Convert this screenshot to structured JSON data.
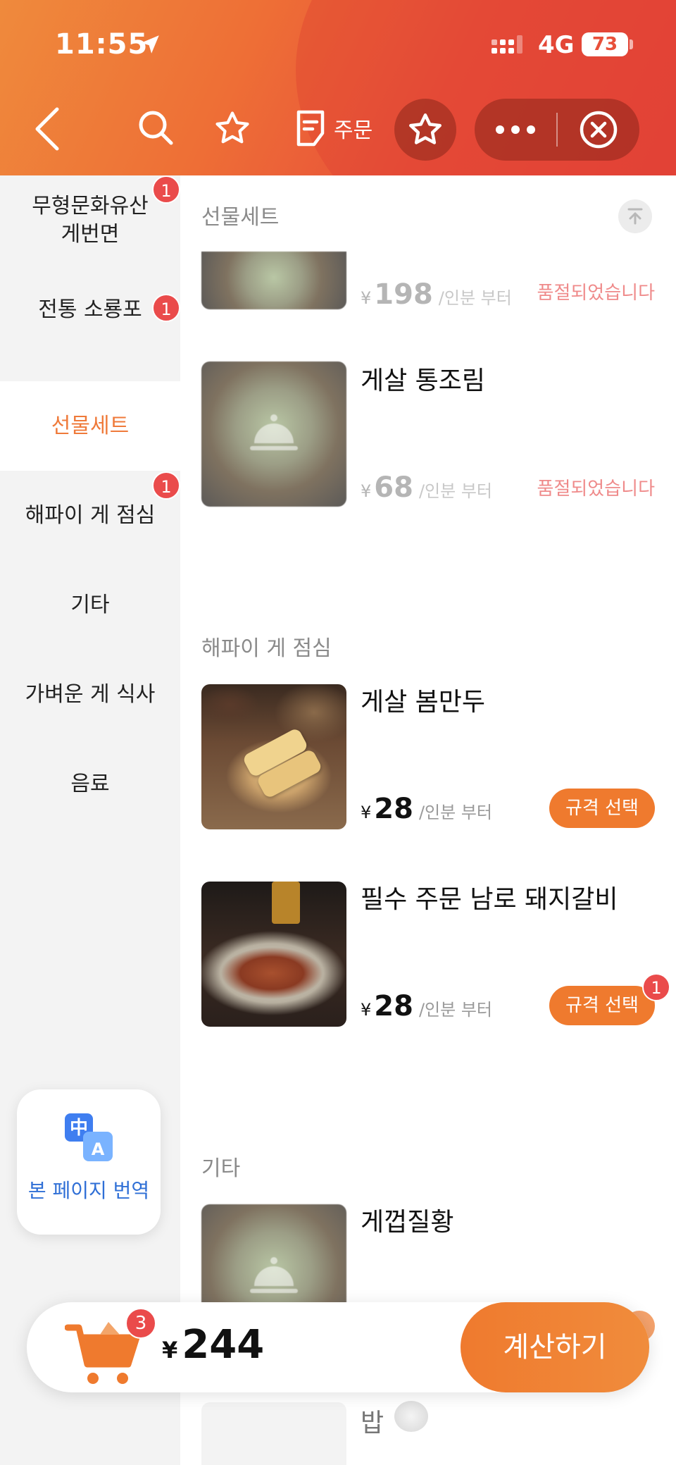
{
  "status_bar": {
    "time": "11:55",
    "network": "4G",
    "battery": "73"
  },
  "header": {
    "order_label": "주문",
    "icons": [
      "back-icon",
      "search-icon",
      "star-icon",
      "order-list-icon",
      "star-icon",
      "more-icon",
      "close-circle-icon"
    ]
  },
  "sidebar": {
    "items": [
      {
        "label": "무형문화유산\n게번면",
        "badge": "1"
      },
      {
        "label": "전통 소룡포",
        "badge": "1"
      },
      {
        "label": "선물세트",
        "badge": ""
      },
      {
        "label": "해파이 게 점심",
        "badge": "1"
      },
      {
        "label": "기타",
        "badge": ""
      },
      {
        "label": "가벼운 게 식사",
        "badge": ""
      },
      {
        "label": "음료",
        "badge": ""
      }
    ],
    "active_index": 2,
    "translate_label": "본 페이지 번역"
  },
  "content": {
    "sections": [
      {
        "title": "선물세트",
        "items": [
          {
            "name": "",
            "currency": "¥",
            "price": "198",
            "unit": "/인분 부터",
            "status": "품절되었습니다"
          },
          {
            "name": "게살 통조림",
            "currency": "¥",
            "price": "68",
            "unit": "/인분 부터",
            "status": "품절되었습니다"
          }
        ]
      },
      {
        "title": "해파이 게 점심",
        "items": [
          {
            "name": "게살 봄만두",
            "currency": "¥",
            "price": "28",
            "unit": "/인분 부터",
            "button": "규격 선택"
          },
          {
            "name": "필수 주문 남로 돼지갈비",
            "currency": "¥",
            "price": "28",
            "unit": "/인분 부터",
            "button": "규격 선택",
            "badge": "1"
          }
        ]
      },
      {
        "title": "기타",
        "items": [
          {
            "name": "게껍질황"
          },
          {
            "name": "밥"
          }
        ]
      }
    ]
  },
  "cart": {
    "count": "3",
    "currency": "¥",
    "total": "244",
    "checkout_label": "계산하기"
  },
  "colors": {
    "accent": "#ef7a2e",
    "badge": "#ea4b4b",
    "soldout": "#ef8a8a",
    "translate": "#2f6fd6"
  }
}
